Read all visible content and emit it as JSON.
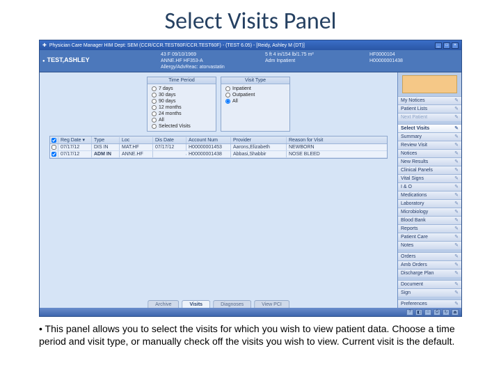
{
  "slide": {
    "title": "Select Visits Panel",
    "caption": "• This panel allows you to select the visits for which you wish to view patient data. Choose a time period and visit type, or manually check off the visits you wish to view. Current visit is the default."
  },
  "titlebar": {
    "app_icon": "medkit-icon",
    "title": "Physician Care Manager   HIM Dept: SEM  (CCR/CCR.TEST60F/CCR.TEST60F) - (TEST 6.05) - [Reidy, Ashley M (DT)]",
    "min": "_",
    "max": "□",
    "close": "×"
  },
  "patient": {
    "name": "TEST,ASHLEY",
    "demo_line1": "43 F 09/10/1969",
    "demo_line2": "ANNE.HF HF353-A",
    "demo_line3": "Allergy/AdvReac: atorvastatin",
    "stats_line1": "5 ft 4 in/154 lb/1.75 m²",
    "stats_line2": "Adm Inpatient",
    "id_line1": "HF0000104",
    "id_line2": "H00000001438"
  },
  "filters": {
    "time_period": {
      "title": "Time Period",
      "options": [
        "7 days",
        "30 days",
        "90 days",
        "12 months",
        "24 months",
        "All",
        "Selected Visits"
      ],
      "selected_index": null
    },
    "visit_type": {
      "title": "Visit Type",
      "options": [
        "Inpatient",
        "Outpatient",
        "All"
      ],
      "selected_index": 2
    }
  },
  "table": {
    "columns": [
      "",
      "Reg Date ▾",
      "Type",
      "Loc",
      "Dis Date",
      "Account Num",
      "Provider",
      "Reason for Visit"
    ],
    "rows": [
      {
        "checked": false,
        "cells": [
          "07/17/12",
          "DIS IN",
          "MAT.HF",
          "07/17/12",
          "H00000001453",
          "Aarons,Elizabeth",
          "NEWBORN"
        ]
      },
      {
        "checked": true,
        "cells": [
          "07/17/12",
          "ADM IN",
          "ANNE.HF",
          "",
          "H00000001438",
          "Abbasi,Shabbir",
          "NOSE BLEED"
        ]
      }
    ]
  },
  "tabs": {
    "items": [
      "Archive",
      "Visits",
      "Diagnoses",
      "View PCI"
    ],
    "active_index": 1
  },
  "sidebar": {
    "items": [
      {
        "label": "My Notices"
      },
      {
        "label": "Patient Lists"
      },
      {
        "label": "Next Patient",
        "dim": true,
        "spacer_after": true
      },
      {
        "label": "Select Visits",
        "active": true
      },
      {
        "label": "Summary"
      },
      {
        "label": "Review Visit"
      },
      {
        "label": "Notices"
      },
      {
        "label": "New Results"
      },
      {
        "label": "Clinical Panels"
      },
      {
        "label": "Vital Signs"
      },
      {
        "label": "I & O"
      },
      {
        "label": "Medications"
      },
      {
        "label": "Laboratory"
      },
      {
        "label": "Microbiology"
      },
      {
        "label": "Blood Bank"
      },
      {
        "label": "Reports"
      },
      {
        "label": "Patient Care"
      },
      {
        "label": "Notes",
        "spacer_after": true
      },
      {
        "label": "Orders"
      },
      {
        "label": "Amb Orders"
      },
      {
        "label": "Discharge Plan",
        "spacer_after": true
      },
      {
        "label": "Document"
      },
      {
        "label": "Sign",
        "spacer_after": true
      },
      {
        "label": "Preferences"
      }
    ]
  },
  "statusbar": {
    "icons": [
      "?",
      "◧",
      "⌂",
      "⎙",
      "↻",
      "⏏"
    ]
  }
}
